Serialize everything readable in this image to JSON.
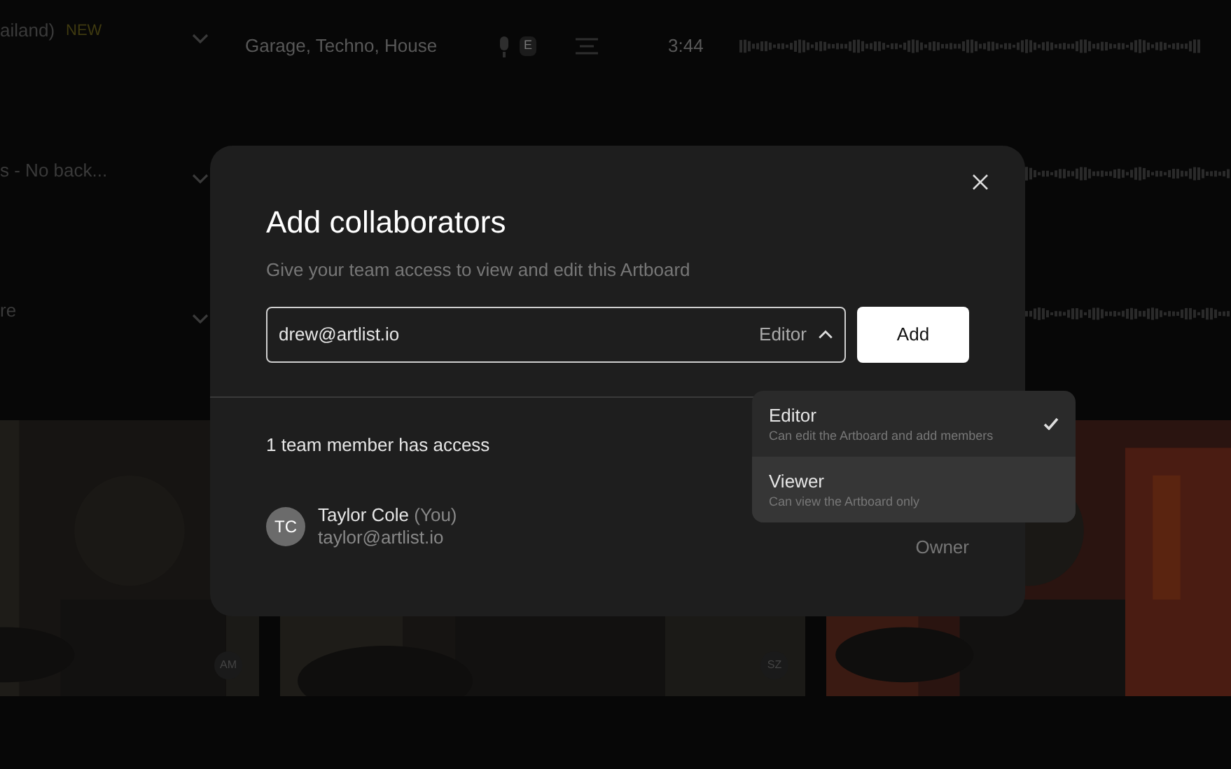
{
  "tracks": [
    {
      "title": "ailand)",
      "badge": "NEW",
      "genres": "Garage, Techno, House",
      "explicit": "E",
      "duration": "3:44"
    },
    {
      "title": "s - No back..."
    },
    {
      "title": "re"
    }
  ],
  "photos": [
    {
      "kind": "picture",
      "avatar": "AM"
    },
    {
      "kind": "picture",
      "avatar": "SZ"
    },
    {
      "kind": "picture"
    }
  ],
  "dialog": {
    "title": "Add collaborators",
    "subtitle": "Give your team access to view and edit this Artboard",
    "email": {
      "value": "drew@artlist.io"
    },
    "role": {
      "label": "Editor",
      "expanded": true
    },
    "add_button": "Add",
    "members_heading": "1 team member has access",
    "members": [
      {
        "initials": "TC",
        "name": "Taylor Cole",
        "you": "(You)",
        "email": "taylor@artlist.io",
        "role": "Owner"
      }
    ],
    "role_menu": [
      {
        "label": "Editor",
        "description": "Can edit the Artboard and add members",
        "selected": true,
        "highlighted": false
      },
      {
        "label": "Viewer",
        "description": "Can view the Artboard only",
        "selected": false,
        "highlighted": true
      }
    ]
  }
}
